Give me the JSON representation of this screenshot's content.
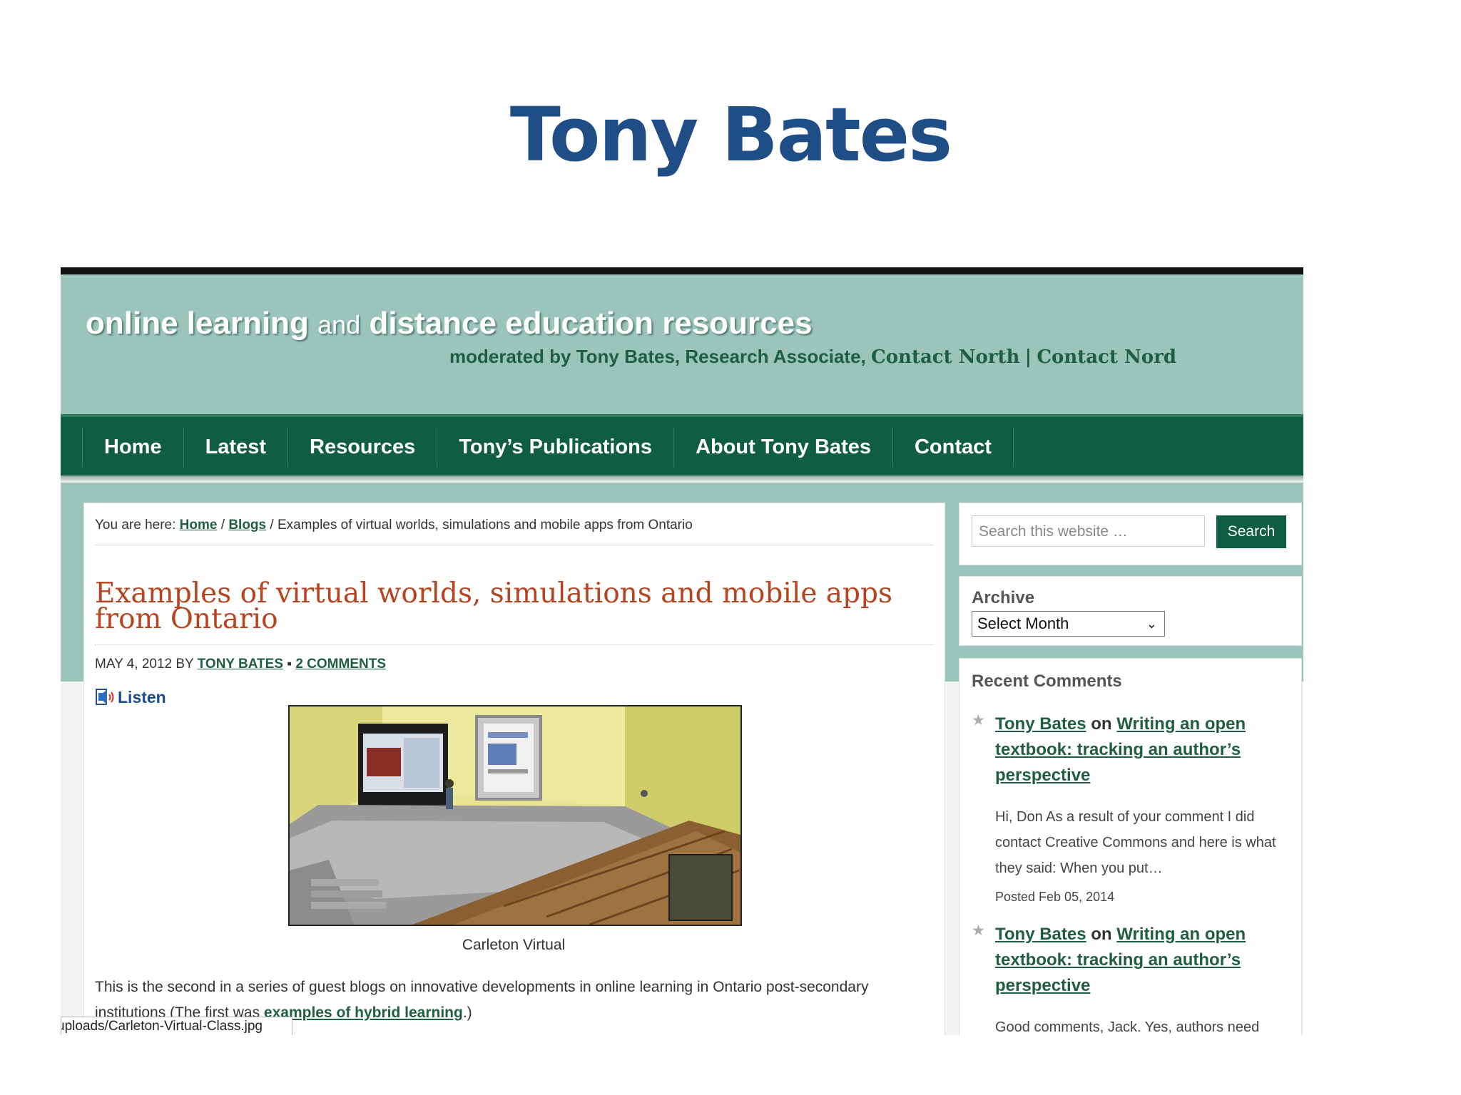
{
  "slide": {
    "title": "Tony Bates"
  },
  "site": {
    "title_part1": "online learning",
    "title_part2": "and",
    "title_part3": "distance education resources",
    "tagline_part1": "moderated by Tony Bates, Research Associate,",
    "tagline_part2": "Contact North",
    "tagline_sep": "|",
    "tagline_part3": "Contact Nord"
  },
  "nav": {
    "home": "Home",
    "latest": "Latest",
    "resources": "Resources",
    "publications": "Tony’s Publications",
    "about": "About Tony Bates",
    "contact": "Contact"
  },
  "breadcrumb": {
    "prefix": "You are here:",
    "home": "Home",
    "sep1": "/",
    "blogs": "Blogs",
    "sep2": "/",
    "current": "Examples of virtual worlds, simulations and mobile apps from Ontario"
  },
  "post": {
    "title": "Examples of virtual worlds, simulations and mobile apps from Ontario",
    "date_by": "MAY 4, 2012 BY",
    "author": "TONY BATES",
    "bullet": "▪",
    "comments": "2 COMMENTS",
    "listen": "Listen",
    "image_caption": "Carleton Virtual",
    "body_line1": "This is the second in a series of guest blogs on innovative developments in online learning in Ontario post-secondary",
    "body_line2_text": "institutions (The first was",
    "body_line2_link": "examples of hybrid learning",
    "body_line2_end": ".)",
    "status_url": "uploads/Carleton-Virtual-Class.jpg"
  },
  "sidebar": {
    "search_placeholder": "Search this website …",
    "search_button": "Search",
    "archive_title": "Archive",
    "archive_select": "Select Month",
    "recent_title": "Recent Comments",
    "comments": [
      {
        "author": "Tony Bates",
        "on": "on",
        "post": "Writing an open textbook: tracking an author’s perspective",
        "excerpt": "Hi, Don As a result of your comment I did contact Creative Commons and here is what they said: When you put…",
        "date": "Posted Feb 05, 2014"
      },
      {
        "author": "Tony Bates",
        "on": "on",
        "post": "Writing an open textbook: tracking an author’s perspective",
        "excerpt": "Good comments, Jack. Yes, authors need",
        "date": ""
      }
    ]
  },
  "colors": {
    "slide_title": "#1f4e87",
    "banner": "#9bc5bb",
    "nav": "#0f5e43",
    "post_title": "#b5441f",
    "link": "#1f5e42"
  }
}
